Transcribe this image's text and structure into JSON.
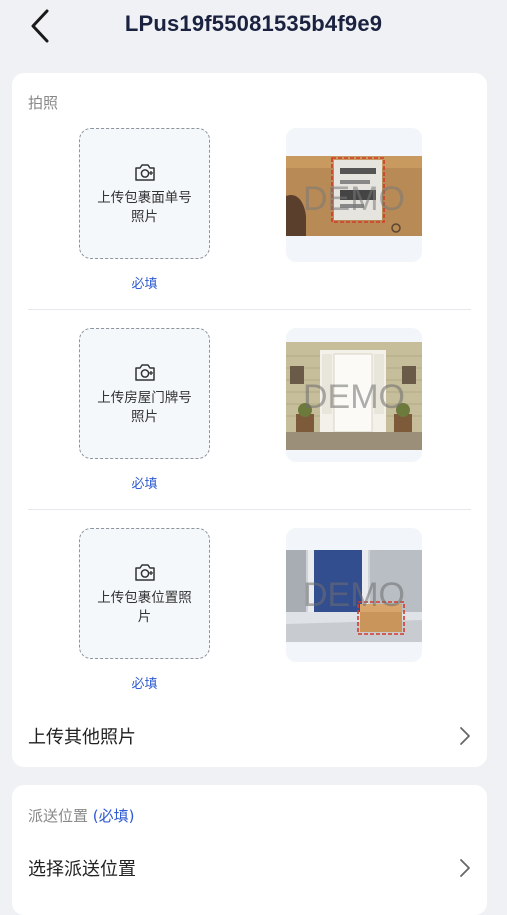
{
  "header": {
    "title": "LPus19f55081535b4f9e9",
    "back_icon": "chevron-left-icon"
  },
  "photo_section": {
    "label": "拍照",
    "items": [
      {
        "upload_label": "上传包裹面单号照片",
        "line1": "上传包裹面单号",
        "line2": "照片",
        "required": "必填",
        "sample_watermark": "DEMO"
      },
      {
        "upload_label": "上传房屋门牌号照片",
        "line1": "上传房屋门牌号",
        "line2": "照片",
        "required": "必填",
        "sample_watermark": "DEMO"
      },
      {
        "upload_label": "上传包裹位置照片",
        "line1": "上传包裹位置照",
        "line2": "片",
        "required": "必填",
        "sample_watermark": "DEMO"
      }
    ],
    "other_photos": "上传其他照片"
  },
  "delivery_section": {
    "label": "派送位置",
    "required": "(必填)",
    "select_label": "选择派送位置"
  },
  "colors": {
    "accent": "#2f5bd3",
    "title": "#1a2240",
    "background": "#f0f1f5"
  }
}
